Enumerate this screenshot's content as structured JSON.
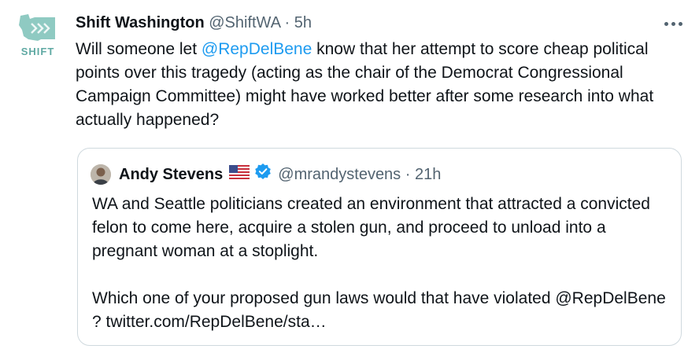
{
  "tweet": {
    "avatar_text": "SHIFT",
    "name": "Shift Washington",
    "handle": "@ShiftWA",
    "separator": "·",
    "time": "5h",
    "text_before": "Will someone let ",
    "mention": "@RepDelBene",
    "text_after": " know that her attempt to score cheap political points over this tragedy (acting as the chair of the Democrat Congressional Campaign Committee) might have worked better after some research into what actually happened?",
    "more_icon": "more-horizontal-icon"
  },
  "quote": {
    "name": "Andy Stevens",
    "flag_icon": "us-flag-icon",
    "verified_icon": "verified-badge-icon",
    "handle": "@mrandystevens",
    "separator": "·",
    "time": "21h",
    "paragraph1": "WA and Seattle politicians created an environment that attracted a convicted felon to come here, acquire a stolen gun, and proceed to unload into a pregnant woman at a stoplight.",
    "paragraph2": "Which one of your proposed gun laws would that have violated @RepDelBene ? twitter.com/RepDelBene/sta…"
  },
  "colors": {
    "accent": "#1d9bf0",
    "muted": "#536471",
    "logo": "#5fa9a3",
    "border": "#cfd9de"
  }
}
